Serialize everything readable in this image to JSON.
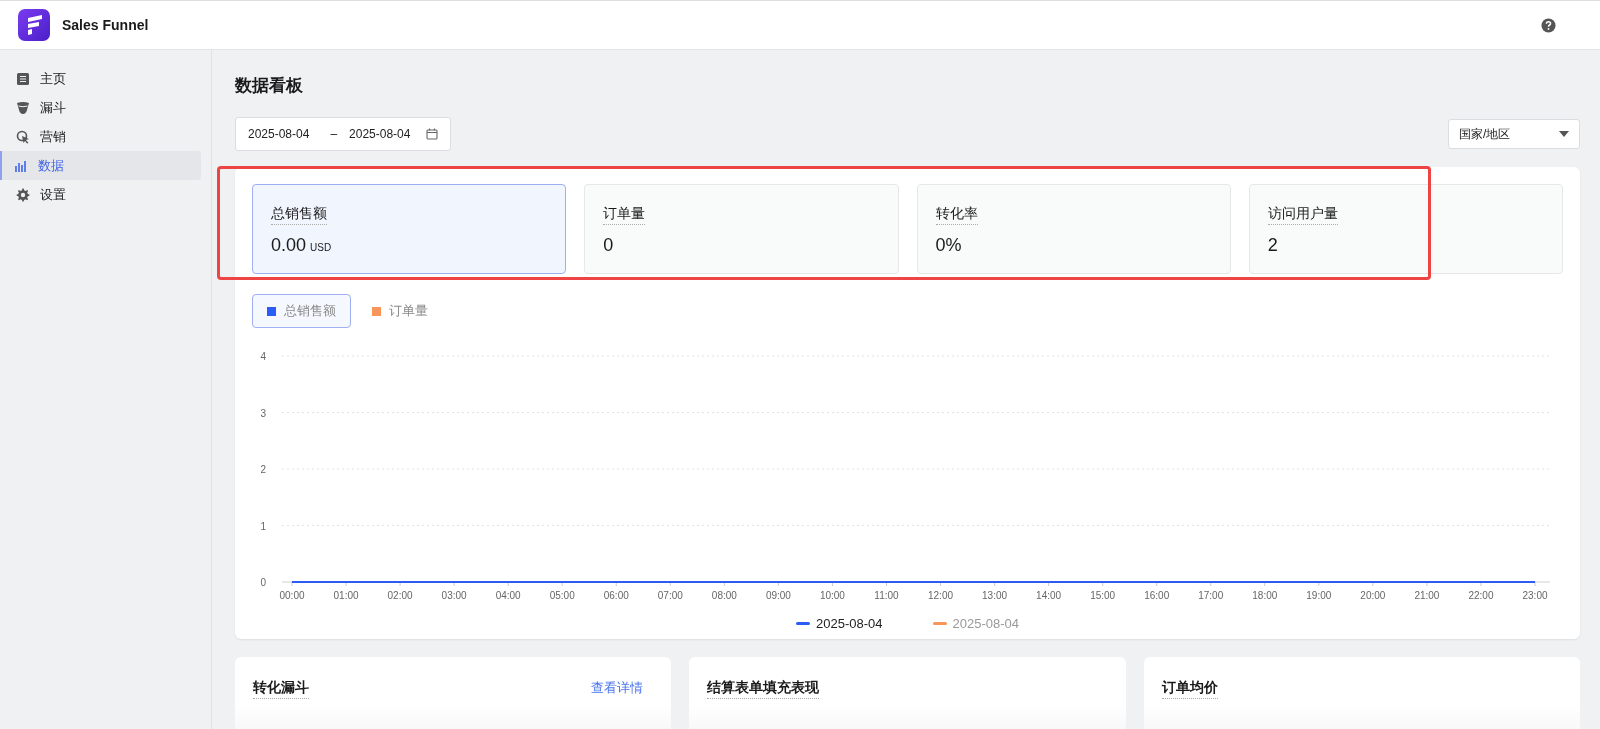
{
  "app": {
    "title": "Sales Funnel"
  },
  "sidebar": {
    "items": [
      {
        "label": "主页",
        "selected": false
      },
      {
        "label": "漏斗",
        "selected": false
      },
      {
        "label": "营销",
        "selected": false
      },
      {
        "label": "数据",
        "selected": true
      },
      {
        "label": "设置",
        "selected": false
      }
    ]
  },
  "page": {
    "title": "数据看板"
  },
  "date_range": {
    "start": "2025-08-04",
    "separator": "–",
    "end": "2025-08-04"
  },
  "region_select": {
    "value": "国家/地区"
  },
  "stats": [
    {
      "label": "总销售额",
      "value": "0.00",
      "unit": "USD",
      "selected": true
    },
    {
      "label": "订单量",
      "value": "0",
      "selected": false
    },
    {
      "label": "转化率",
      "value": "0%",
      "selected": false
    },
    {
      "label": "访问用户量",
      "value": "2",
      "selected": false
    }
  ],
  "metric_tabs": [
    {
      "label": "总销售额",
      "color": "#2b5cf5",
      "selected": true
    },
    {
      "label": "订单量",
      "color": "#f7955a",
      "selected": false
    }
  ],
  "chart_data": {
    "type": "line",
    "x": [
      "00:00",
      "01:00",
      "02:00",
      "03:00",
      "04:00",
      "05:00",
      "06:00",
      "07:00",
      "08:00",
      "09:00",
      "10:00",
      "11:00",
      "12:00",
      "13:00",
      "14:00",
      "15:00",
      "16:00",
      "17:00",
      "18:00",
      "19:00",
      "20:00",
      "21:00",
      "22:00",
      "23:00"
    ],
    "yticks": [
      0,
      1,
      2,
      3,
      4
    ],
    "ylim": [
      0,
      4
    ],
    "grid": true,
    "series": [
      {
        "name": "2025-08-04",
        "color": "#2b5cf5",
        "values": [
          0,
          0,
          0,
          0,
          0,
          0,
          0,
          0,
          0,
          0,
          0,
          0,
          0,
          0,
          0,
          0,
          0,
          0,
          0,
          0,
          0,
          0,
          0,
          0
        ]
      },
      {
        "name": "2025-08-04",
        "color": "#f7955a",
        "values": [
          null,
          null,
          null,
          null,
          null,
          null,
          null,
          null,
          null,
          null,
          null,
          null,
          null,
          null,
          null,
          null,
          null,
          null,
          null,
          null,
          null,
          null,
          null,
          null
        ]
      }
    ]
  },
  "chart_legend": [
    {
      "active": true
    },
    {
      "active": false
    }
  ],
  "bottom_cards": [
    {
      "title": "转化漏斗",
      "link": "查看详情"
    },
    {
      "title": "结算表单填充表现"
    },
    {
      "title": "订单均价"
    }
  ]
}
